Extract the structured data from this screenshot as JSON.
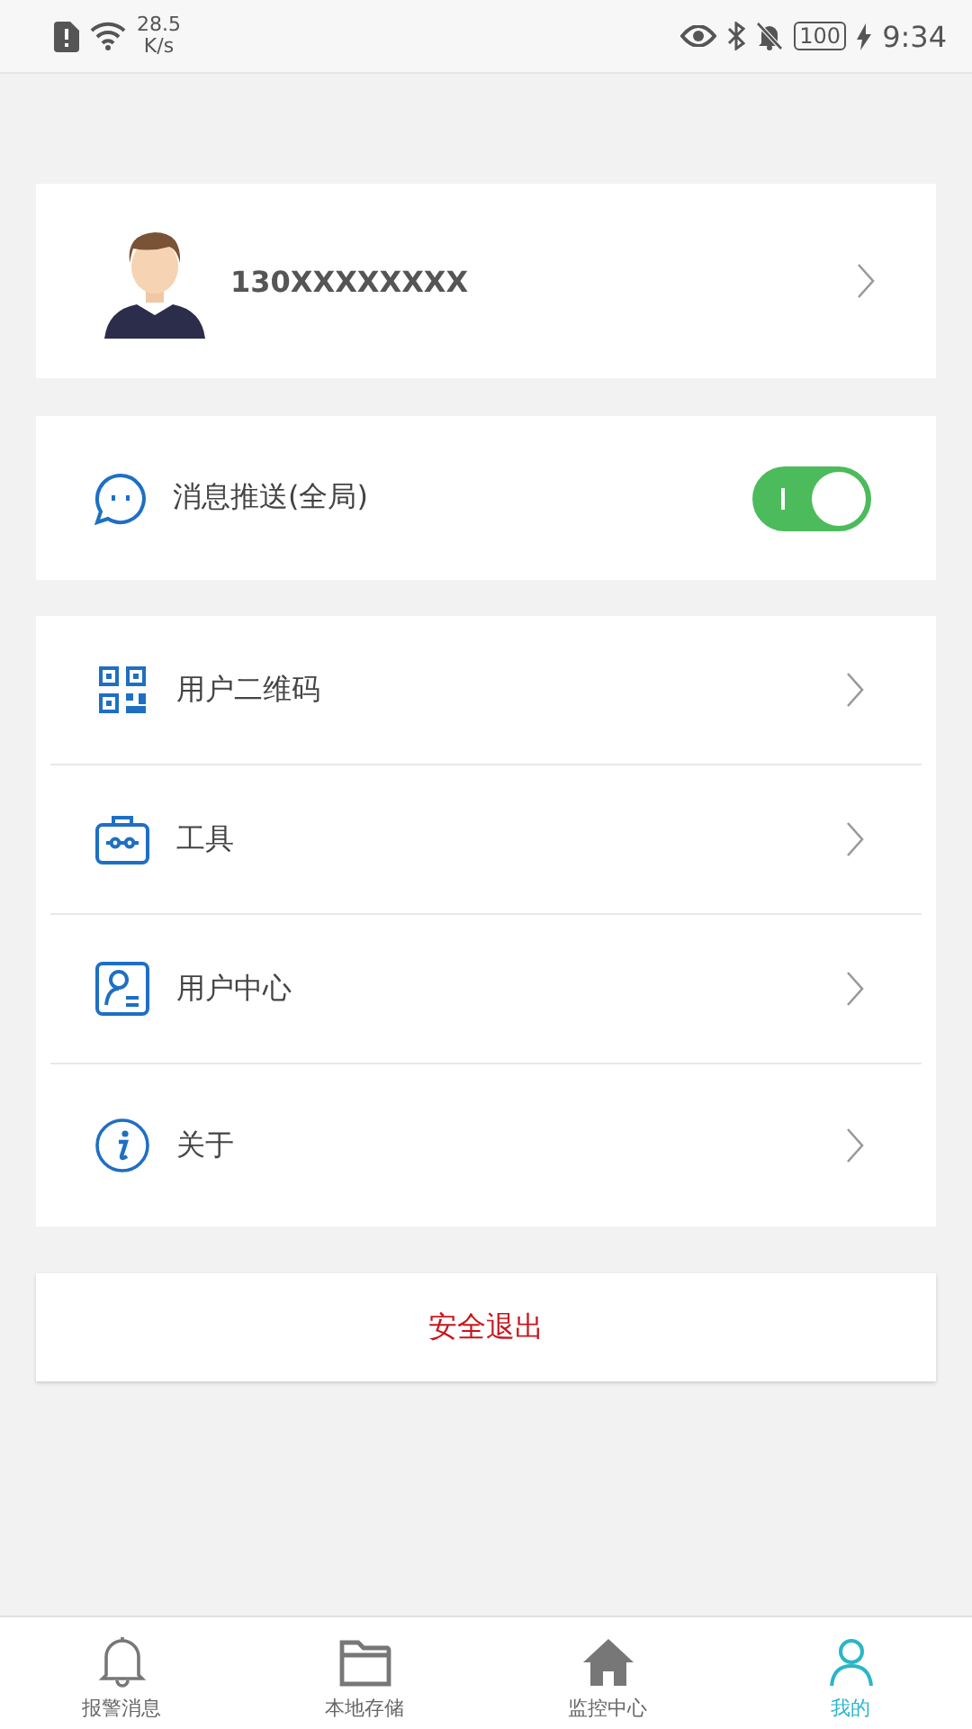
{
  "status_bar": {
    "speed": "28.5",
    "speed_unit": "K/s",
    "battery": "100",
    "time": "9:34"
  },
  "profile": {
    "phone": "130XXXXXXXX"
  },
  "push": {
    "label": "消息推送(全局)",
    "on": true
  },
  "menu": [
    {
      "kind": "qr",
      "label": "用户二维码"
    },
    {
      "kind": "toolbox",
      "label": "工具"
    },
    {
      "kind": "user-card",
      "label": "用户中心"
    },
    {
      "kind": "info",
      "label": "关于"
    }
  ],
  "logout": {
    "label": "安全退出"
  },
  "tabs": [
    {
      "kind": "bell",
      "label": "报警消息",
      "selected": false
    },
    {
      "kind": "folder",
      "label": "本地存储",
      "selected": false
    },
    {
      "kind": "home",
      "label": "监控中心",
      "selected": false
    },
    {
      "kind": "person",
      "label": "我的",
      "selected": true
    }
  ]
}
